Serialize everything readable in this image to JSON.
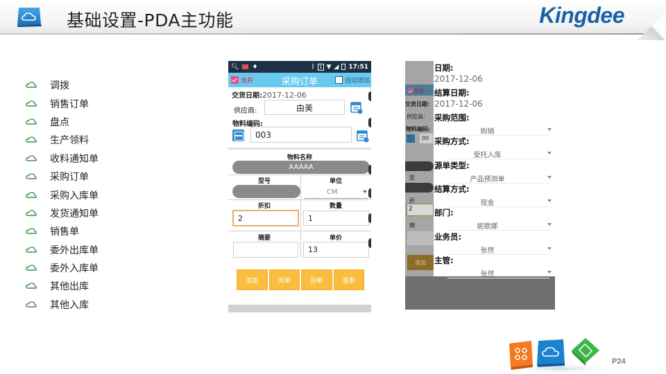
{
  "header": {
    "title": "基础设置-PDA主功能",
    "brand": "Kingdee"
  },
  "feature_list": [
    "调拨",
    "销售订单",
    "盘点",
    "生产领料",
    "收料通知单",
    "采购订单",
    "采购入库单",
    "发货通知单",
    "销售单",
    "委外出库单",
    "委外入库单",
    "其他出库",
    "其他入库"
  ],
  "phone1": {
    "status_time": "17:51",
    "status_sim": "1",
    "merge_label": "合并",
    "screen_title": "采购订单",
    "auto_add_label": "自动添加",
    "delivery_date_label": "交货日期:",
    "delivery_date_value": "2017-12-06",
    "supplier_label": "供应商:",
    "supplier_value": "由美",
    "material_code_label": "物料编码:",
    "material_code_value": "003",
    "material_name_header": "物料名称",
    "material_name_value": "AAAAA",
    "model_header": "型号",
    "unit_header": "单位",
    "unit_value": "CM",
    "discount_header": "折扣",
    "quantity_header": "数量",
    "discount_value": "2",
    "quantity_value": "1",
    "summary_header": "摘要",
    "price_header": "单价",
    "price_value": "13",
    "buttons": [
      "添加",
      "完单",
      "回单",
      "查看"
    ]
  },
  "phone2": {
    "background": {
      "merge_label": "合并",
      "delivery_label": "交货日期:",
      "supplier_label": "供应商:",
      "material_label": "物料编码:",
      "model_abbr": "型",
      "discount_abbr": "折",
      "discount_value": "2",
      "summary_abbr": "摘",
      "add_button": "添加",
      "code_partial": "00"
    },
    "popup": [
      {
        "label": "日期:",
        "value": "2017-12-06",
        "kind": "text"
      },
      {
        "label": "结算日期:",
        "value": "2017-12-06",
        "kind": "text"
      },
      {
        "label": "采购范围:",
        "value": "购销",
        "kind": "select"
      },
      {
        "label": "采购方式:",
        "value": "受托入库",
        "kind": "select"
      },
      {
        "label": "源单类型:",
        "value": "产品预测单",
        "kind": "select"
      },
      {
        "label": "结算方式:",
        "value": "现金",
        "kind": "select"
      },
      {
        "label": "部门:",
        "value": "妮歌娜",
        "kind": "select"
      },
      {
        "label": "业务员:",
        "value": "张然",
        "kind": "select"
      },
      {
        "label": "主管:",
        "value": "张然",
        "kind": "select"
      }
    ]
  },
  "footer": {
    "page_number": "P24"
  },
  "colors": {
    "brand_blue": "#1a62a8",
    "title_bar": "#6ac9ee",
    "status_bar": "#1e3046",
    "action_button": "#fbbd3e",
    "checkbox_checked": "#e84e8a"
  }
}
